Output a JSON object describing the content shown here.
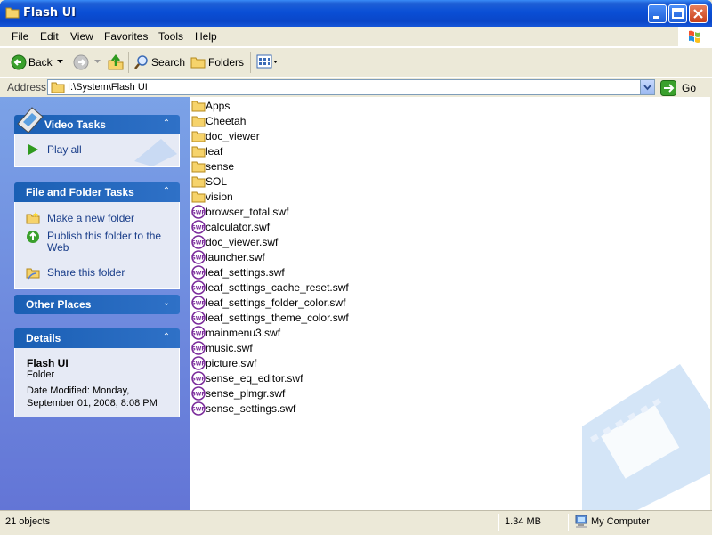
{
  "window": {
    "title": "Flash UI"
  },
  "menu": [
    "File",
    "Edit",
    "View",
    "Favorites",
    "Tools",
    "Help"
  ],
  "toolbar": {
    "back": "Back",
    "search": "Search",
    "folders": "Folders"
  },
  "address": {
    "label": "Address",
    "value": "I:\\System\\Flash UI",
    "go": "Go"
  },
  "sidebar": {
    "video_tasks": {
      "title": "Video Tasks",
      "items": [
        "Play all"
      ]
    },
    "file_folder_tasks": {
      "title": "File and Folder Tasks",
      "items": [
        "Make a new folder",
        "Publish this folder to the Web",
        "Share this folder"
      ]
    },
    "other_places": {
      "title": "Other Places"
    },
    "details": {
      "title": "Details",
      "name": "Flash UI",
      "type": "Folder",
      "modified_line1": "Date Modified: Monday,",
      "modified_line2": "September 01, 2008, 8:08 PM"
    }
  },
  "files": [
    {
      "name": "Apps",
      "type": "folder"
    },
    {
      "name": "Cheetah",
      "type": "folder"
    },
    {
      "name": "doc_viewer",
      "type": "folder"
    },
    {
      "name": "leaf",
      "type": "folder"
    },
    {
      "name": "sense",
      "type": "folder"
    },
    {
      "name": "SOL",
      "type": "folder"
    },
    {
      "name": "vision",
      "type": "folder"
    },
    {
      "name": "browser_total.swf",
      "type": "swf"
    },
    {
      "name": "calculator.swf",
      "type": "swf"
    },
    {
      "name": "doc_viewer.swf",
      "type": "swf"
    },
    {
      "name": "launcher.swf",
      "type": "swf"
    },
    {
      "name": "leaf_settings.swf",
      "type": "swf"
    },
    {
      "name": "leaf_settings_cache_reset.swf",
      "type": "swf"
    },
    {
      "name": "leaf_settings_folder_color.swf",
      "type": "swf"
    },
    {
      "name": "leaf_settings_theme_color.swf",
      "type": "swf"
    },
    {
      "name": "mainmenu3.swf",
      "type": "swf"
    },
    {
      "name": "music.swf",
      "type": "swf"
    },
    {
      "name": "picture.swf",
      "type": "swf"
    },
    {
      "name": "sense_eq_editor.swf",
      "type": "swf"
    },
    {
      "name": "sense_plmgr.swf",
      "type": "swf"
    },
    {
      "name": "sense_settings.swf",
      "type": "swf"
    }
  ],
  "status": {
    "objects": "21 objects",
    "size": "1.34 MB",
    "location": "My Computer"
  },
  "colors": {
    "title_blue": "#0a46c8",
    "sidebar_blue": "#6375d6",
    "link": "#1a3e8a"
  }
}
